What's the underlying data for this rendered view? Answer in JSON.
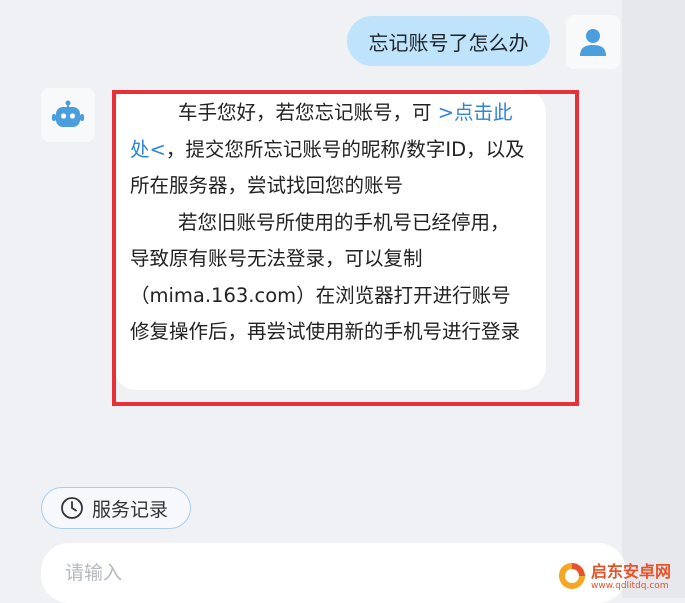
{
  "chat": {
    "user_message": "忘记账号了怎么办",
    "bot_reply": {
      "p1_before": "车手您好，若您忘记账号，可 ",
      "p1_link": ">点击此处<",
      "p1_after": "，提交您所忘记账号的昵称/数字ID，以及所在服务器，尝试找回您的账号",
      "p2": "若您旧账号所使用的手机号已经停用，导致原有账号无法登录，可以复制（mima.163.com）在浏览器打开进行账号修复操作后，再尝试使用新的手机号进行登录"
    }
  },
  "service_record": {
    "label": "服务记录",
    "icon": "clock-icon"
  },
  "input": {
    "placeholder": "请输入",
    "value": ""
  },
  "watermark": {
    "title": "启东安卓网",
    "url": "www.qdlitdq.com"
  },
  "colors": {
    "user_bubble": "#bfe3fb",
    "link": "#2f86d6",
    "highlight_border": "#e53238",
    "avatar_icon": "#4a9ede",
    "watermark": "#e8522a"
  }
}
